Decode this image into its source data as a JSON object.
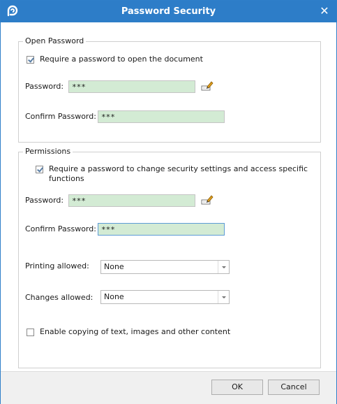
{
  "window": {
    "title": "Password Security"
  },
  "open_password": {
    "legend": "Open Password",
    "require_label": "Require a password to open the document",
    "require_checked": true,
    "password_label": "Password:",
    "password_value": "***",
    "confirm_label": "Confirm Password:",
    "confirm_value": "***"
  },
  "permissions": {
    "legend": "Permissions",
    "require_label_line1": "Require a password to change security settings and access specific",
    "require_label_line2": "functions",
    "require_checked": true,
    "password_label": "Password:",
    "password_value": "***",
    "confirm_label": "Confirm Password:",
    "confirm_value": "***",
    "printing_label": "Printing allowed:",
    "printing_value": "None",
    "changes_label": "Changes allowed:",
    "changes_value": "None",
    "copy_label": "Enable copying of text, images and other content",
    "copy_checked": false
  },
  "buttons": {
    "ok": "OK",
    "cancel": "Cancel"
  },
  "colors": {
    "titlebar": "#2d7dc8",
    "field_bg": "#d3ebd4"
  }
}
